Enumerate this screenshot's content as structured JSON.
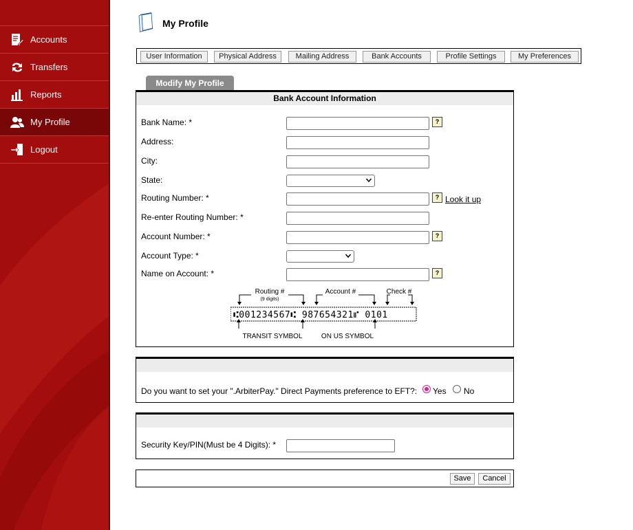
{
  "sidebar": {
    "items": [
      {
        "label": "Accounts",
        "icon": "accounts-icon"
      },
      {
        "label": "Transfers",
        "icon": "transfers-icon"
      },
      {
        "label": "Reports",
        "icon": "reports-icon"
      },
      {
        "label": "My Profile",
        "icon": "profile-icon",
        "active": true
      },
      {
        "label": "Logout",
        "icon": "logout-icon"
      }
    ]
  },
  "header": {
    "title": "My Profile",
    "icon": "profile-book-icon"
  },
  "tabs": [
    {
      "label": "User Information"
    },
    {
      "label": "Physical Address"
    },
    {
      "label": "Mailing Address"
    },
    {
      "label": "Bank Accounts"
    },
    {
      "label": "Profile Settings"
    },
    {
      "label": "My Preferences"
    }
  ],
  "modify_tab": "Modify My Profile",
  "bank": {
    "heading": "Bank Account Information",
    "bank_name_label": "Bank Name: *",
    "address_label": "Address:",
    "city_label": "City:",
    "state_label": "State:",
    "routing_label": "Routing Number: *",
    "routing_reenter_label": "Re-enter Routing Number: *",
    "account_number_label": "Account Number: *",
    "account_type_label": "Account Type: *",
    "name_on_account_label": "Name on Account: *",
    "help_glyph": "?",
    "lookup_link": "Look it up",
    "values": {
      "bank_name": "",
      "address": "",
      "city": "",
      "state": "",
      "routing": "",
      "routing_reenter": "",
      "account_number": "",
      "account_type": "",
      "name_on_account": ""
    }
  },
  "check": {
    "routing_caption": "Routing #",
    "routing_sub": "(9 digits)",
    "account_caption": "Account #",
    "check_caption": "Check #",
    "micr_line": "⑆001234567⑆  987654321⑈  0101",
    "transit_symbol": "TRANSIT SYMBOL",
    "on_us_symbol": "ON US SYMBOL"
  },
  "eft": {
    "question": "Do you want to set your \".ArbiterPay.\" Direct Payments preference to EFT?:",
    "yes_label": "Yes",
    "no_label": "No",
    "selected": "Yes",
    "accent": "#e0218a"
  },
  "security": {
    "label": "Security Key/PIN(Must be 4 Digits): *",
    "value": ""
  },
  "actions": {
    "save": "Save",
    "cancel": "Cancel"
  },
  "colors": {
    "sidebar": "#a30d0d",
    "sidebar_active": "#7a0707",
    "tab_grey": "#8a8a8a",
    "panel_head": "#ececec"
  }
}
